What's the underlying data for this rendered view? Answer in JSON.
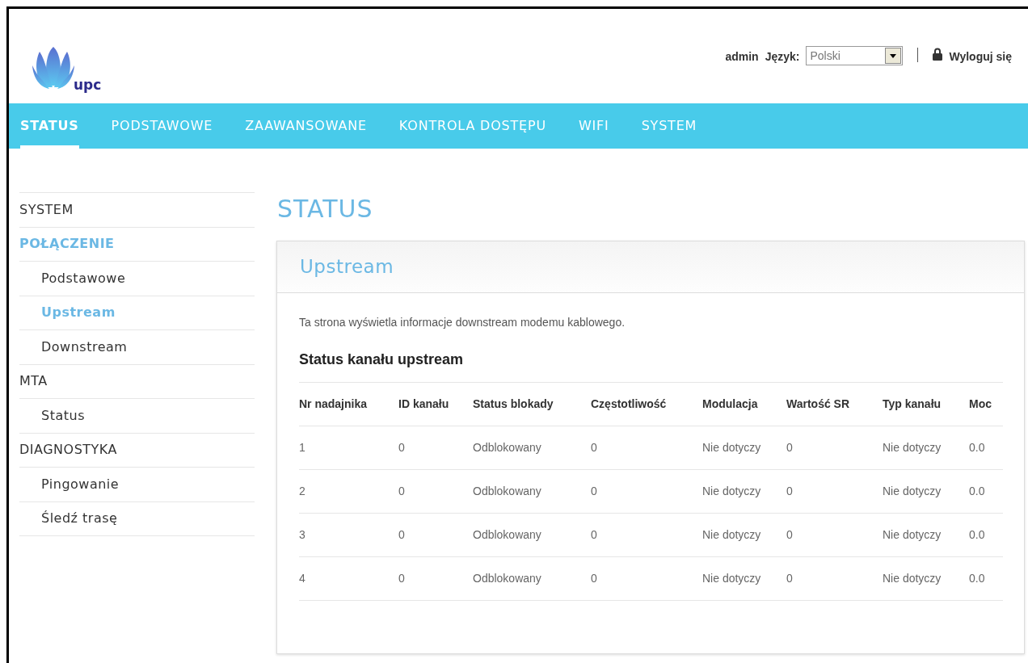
{
  "header": {
    "logo_text": "upc",
    "user": "admin",
    "language_label": "Język:",
    "language_select": {
      "value": "Polski"
    },
    "logout": "Wyloguj się"
  },
  "nav_tabs": [
    {
      "label": "STATUS",
      "selected": true
    },
    {
      "label": "PODSTAWOWE",
      "selected": false
    },
    {
      "label": "ZAAWANSOWANE",
      "selected": false
    },
    {
      "label": "KONTROLA DOSTĘPU",
      "selected": false
    },
    {
      "label": "WIFI",
      "selected": false
    },
    {
      "label": "SYSTEM",
      "selected": false
    }
  ],
  "sidebar": {
    "items": [
      {
        "label": "SYSTEM",
        "selected": false
      },
      {
        "label": "POŁĄCZENIE",
        "selected": true,
        "children": [
          {
            "label": "Podstawowe",
            "selected": false
          },
          {
            "label": "Upstream",
            "selected": true
          },
          {
            "label": "Downstream",
            "selected": false
          }
        ]
      },
      {
        "label": "MTA",
        "selected": false,
        "children": [
          {
            "label": "Status",
            "selected": false
          }
        ]
      },
      {
        "label": "DIAGNOSTYKA",
        "selected": false,
        "children": [
          {
            "label": "Pingowanie",
            "selected": false
          },
          {
            "label": "Śledź trasę",
            "selected": false
          }
        ]
      }
    ]
  },
  "page_title": "STATUS",
  "panel": {
    "title": "Upstream",
    "description": "Ta strona wyświetla informacje downstream modemu kablowego.",
    "section_title": "Status kanału upstream",
    "table": {
      "columns": [
        "Nr nadajnika",
        "ID kanału",
        "Status blokady",
        "Częstotliwość",
        "Modulacja",
        "Wartość SR",
        "Typ kanału",
        "Moc"
      ],
      "rows": [
        [
          "1",
          "0",
          "Odblokowany",
          "0",
          "Nie dotyczy",
          "0",
          "Nie dotyczy",
          "0.0"
        ],
        [
          "2",
          "0",
          "Odblokowany",
          "0",
          "Nie dotyczy",
          "0",
          "Nie dotyczy",
          "0.0"
        ],
        [
          "3",
          "0",
          "Odblokowany",
          "0",
          "Nie dotyczy",
          "0",
          "Nie dotyczy",
          "0.0"
        ],
        [
          "4",
          "0",
          "Odblokowany",
          "0",
          "Nie dotyczy",
          "0",
          "Nie dotyczy",
          "0.0"
        ]
      ]
    }
  }
}
